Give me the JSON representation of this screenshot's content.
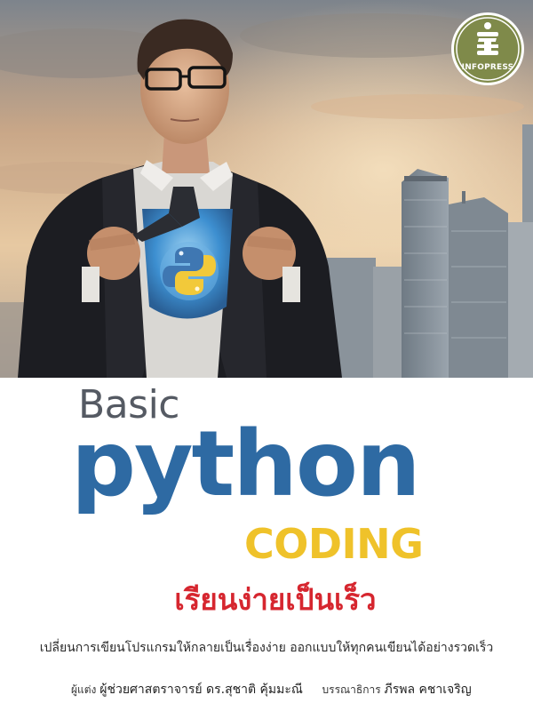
{
  "cover": {
    "publisher": "INFOPRESS",
    "title_basic": "Basic",
    "title_python": "python",
    "title_coding": "CODING",
    "subtitle_thai": "เรียนง่ายเป็นเร็ว",
    "description": "เปลี่ยนการเขียนโปรแกรมให้กลายเป็นเรื่องง่าย ออกแบบให้ทุกคนเขียนได้อย่างรวดเร็ว",
    "author_label": "ผู้แต่ง",
    "author_name": "ผู้ช่วยศาสตราจารย์ ดร.สุชาติ คุ้มมะณี",
    "editor_label": "บรรณาธิการ",
    "editor_name": "ภีรพล คชาเจริญ"
  },
  "colors": {
    "python_blue": "#2e6aa3",
    "coding_yellow": "#efc22a",
    "thai_red": "#d6262f",
    "basic_gray": "#555a63",
    "logo_green": "#7f8a4a"
  },
  "icons": {
    "publisher_logo": "infopress-logo-icon",
    "chest_emblem": "python-logo-icon"
  }
}
